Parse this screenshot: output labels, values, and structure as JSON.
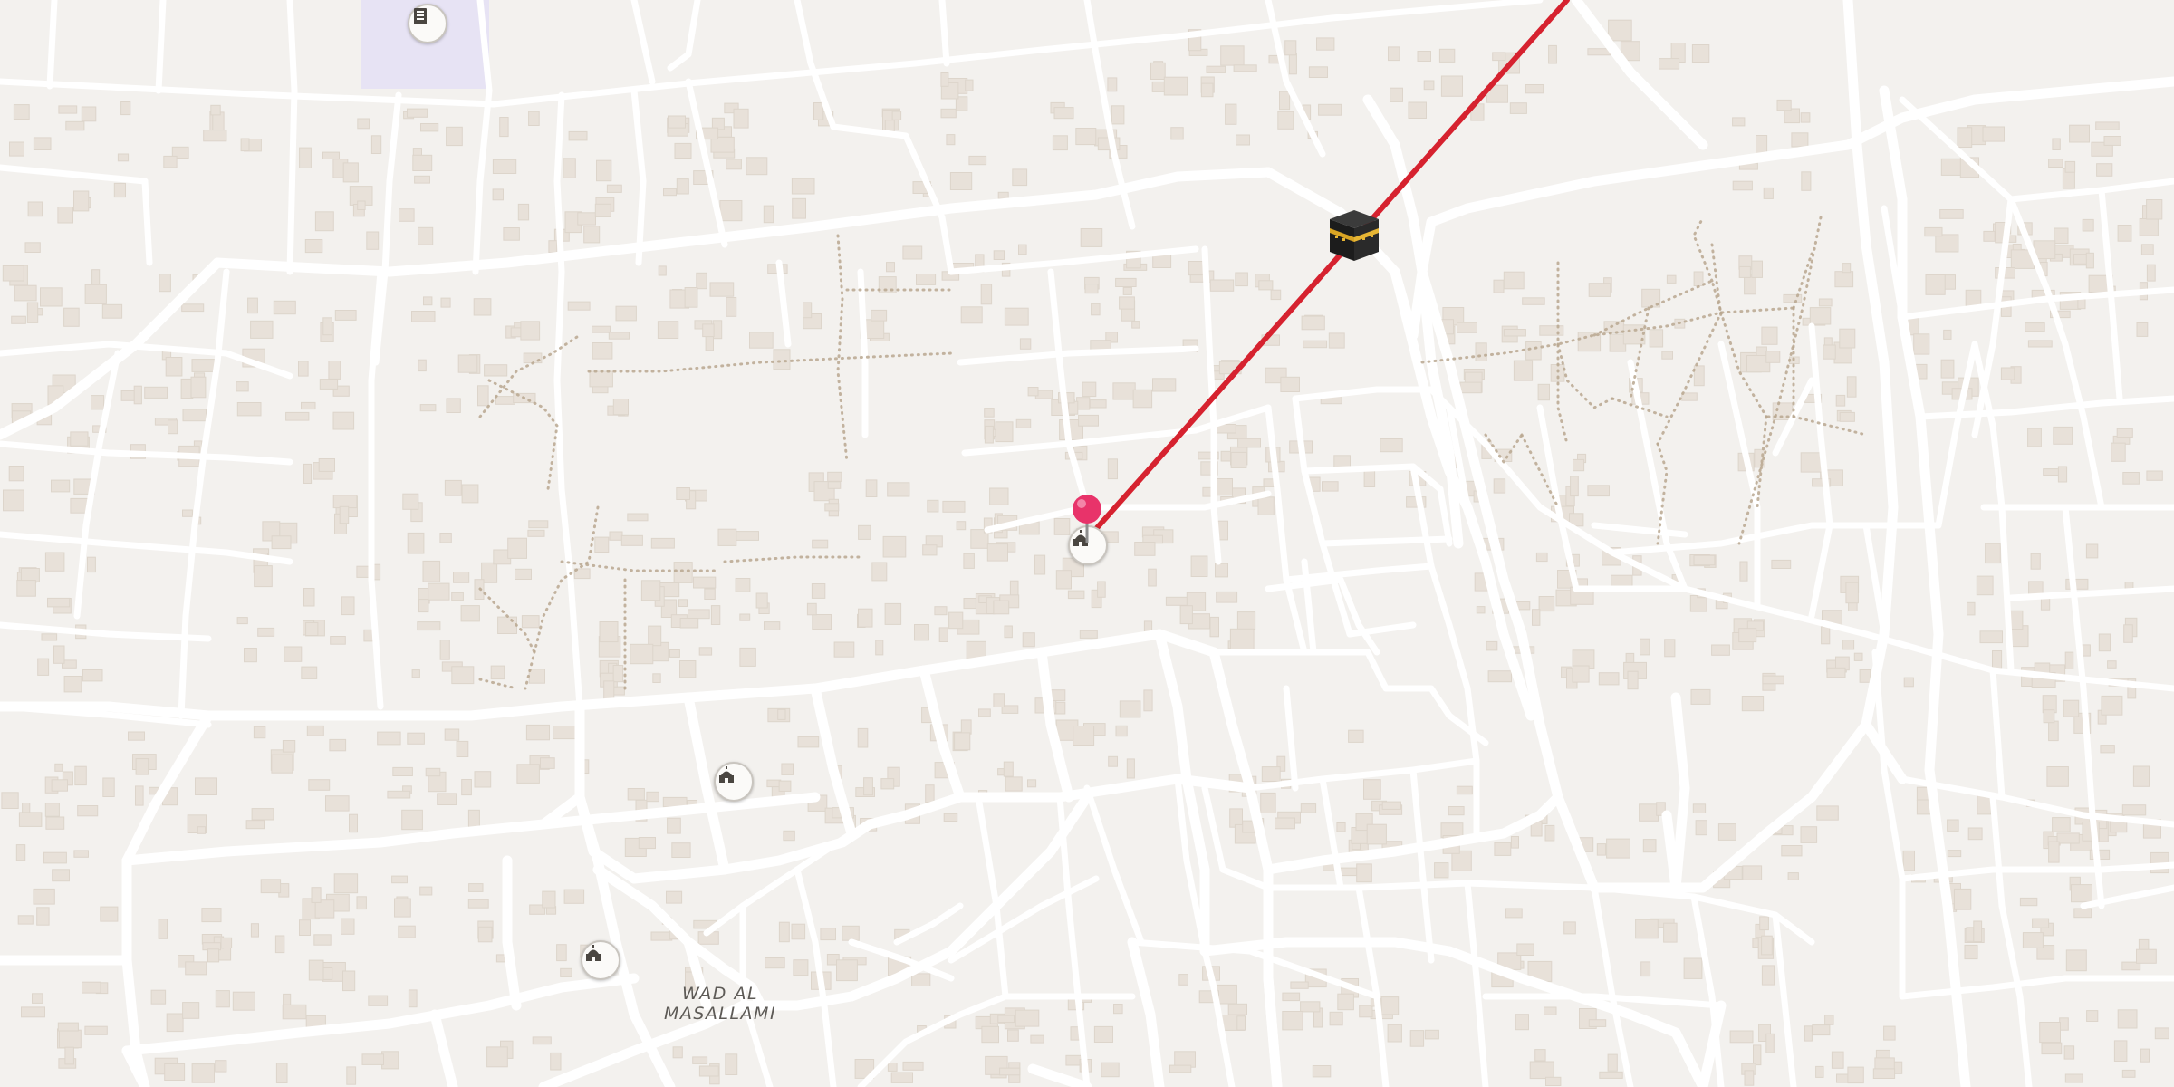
{
  "map": {
    "place_label_line1": "WAD AL",
    "place_label_line2": "MASALLAMI",
    "direction_line_color": "#d6222f",
    "pin_color": "#e8336a",
    "kaaba_marker": "kaaba-icon",
    "mosque_marker": "mosque-icon",
    "school_marker": "school-icon"
  }
}
